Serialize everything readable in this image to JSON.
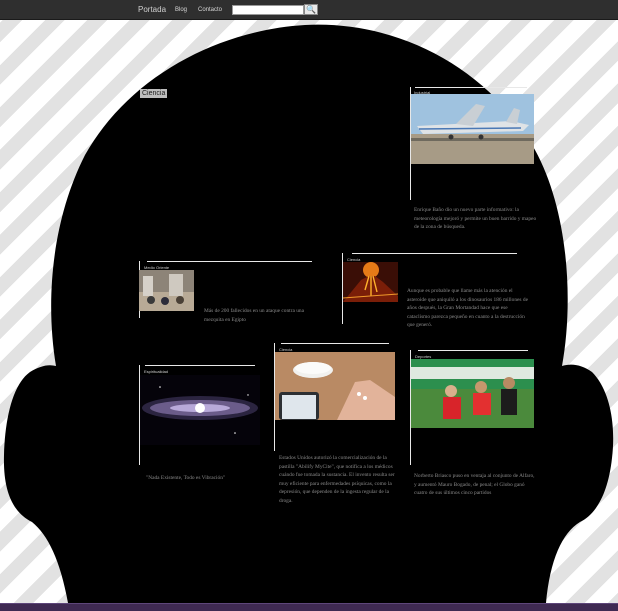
{
  "nav": {
    "home": "Portada",
    "blog": "Blog",
    "contact": "Contacto",
    "search_value": "",
    "search_button": "🔍"
  },
  "section_tag": "Ciencia",
  "articles": [
    {
      "category": "Industrial",
      "text": "Enrique Baño dio un nuevo parte informativo: la meteorología mejoró y permite un buen barrido y mapeo de la zona de búsqueda."
    },
    {
      "category": "Medio Oriente",
      "text": "Más de 200 fallecidos en un ataque contra una mezquita en Egipto"
    },
    {
      "category": "Ciencia",
      "text": "Aunque es probable que llame más la atención el asteroide que aniquiló a los dinosaurios 186 millones de años después, la Gran Mortandad hace que ese cataclismo parezca pequeño en cuanto a la destrucción que generó."
    },
    {
      "category": "Espiritualidad",
      "text": "\"Nada Existente, Todo es Vibración\""
    },
    {
      "category": "Ciencia",
      "text": "Estados Unidos autorizó la comercialización de la pastilla \"Abilify MyCite\", que notifica a los médicos cuándo fue tomada la sustancia. El invento resulta ser muy eficiente para enfermedades psíquicas, como la depresión, que dependen de la ingesta regular de la droga."
    },
    {
      "category": "Deportes",
      "text": "Norberto Briasco puso en ventaja al conjunto de Alfaro, y aumentó Mauro Bogado, de penal; el Globo ganó cuatro de sus últimos cinco partidos"
    }
  ]
}
